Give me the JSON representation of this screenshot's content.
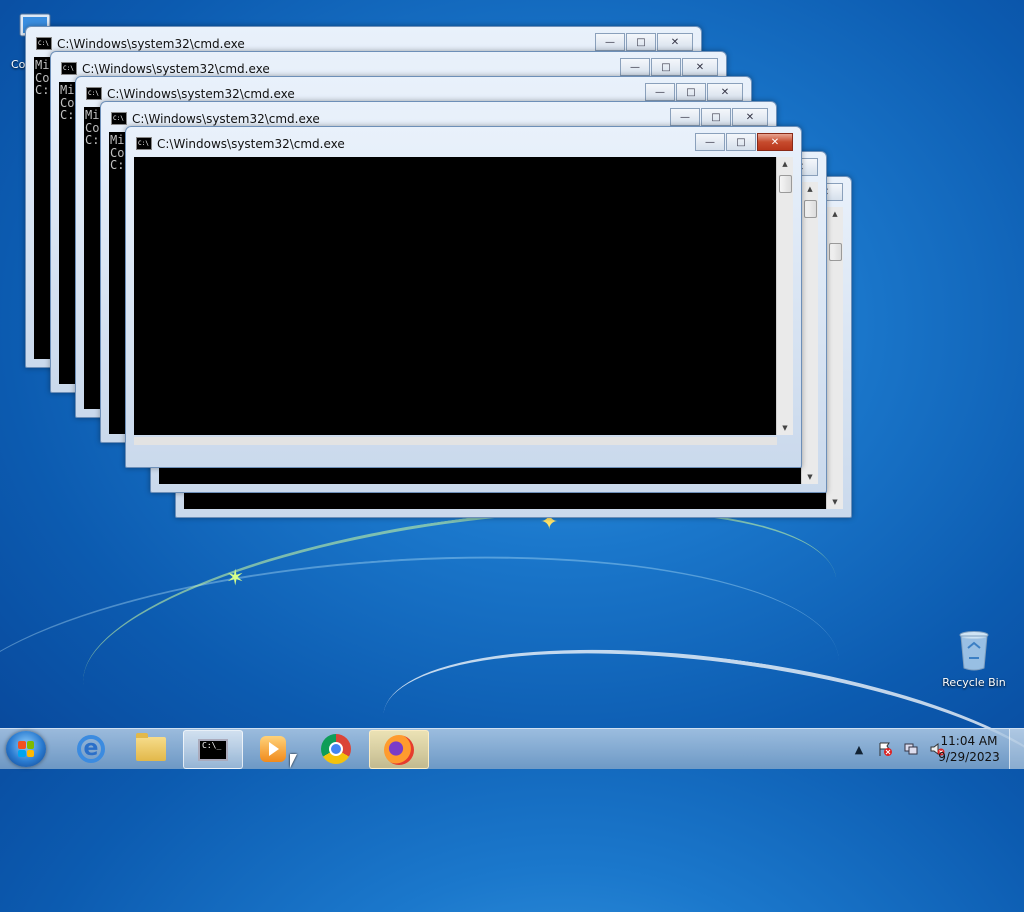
{
  "window_title": "C:\\Windows\\system32\\cmd.exe",
  "console_partial_lines": [
    "Mi",
    "Co",
    "",
    "C:"
  ],
  "caption_buttons": {
    "minimize": "—",
    "maximize": "□",
    "close": "✕"
  },
  "desktop": {
    "computer_label": "Co",
    "recycle_bin_label": "Recycle Bin"
  },
  "taskbar": {
    "cmd_label": "C:\\_",
    "clock_time": "11:04 AM",
    "clock_date": "9/29/2023",
    "tray_up_arrow": "▲",
    "icons": [
      "start-orb-icon",
      "internet-explorer-icon",
      "file-explorer-icon",
      "command-prompt-icon",
      "windows-media-player-icon",
      "chrome-icon",
      "firefox-icon"
    ]
  },
  "colors": {
    "desktop_blue": "#1b78cc",
    "console_bg": "#000000",
    "close_red": "#c64b2d"
  }
}
